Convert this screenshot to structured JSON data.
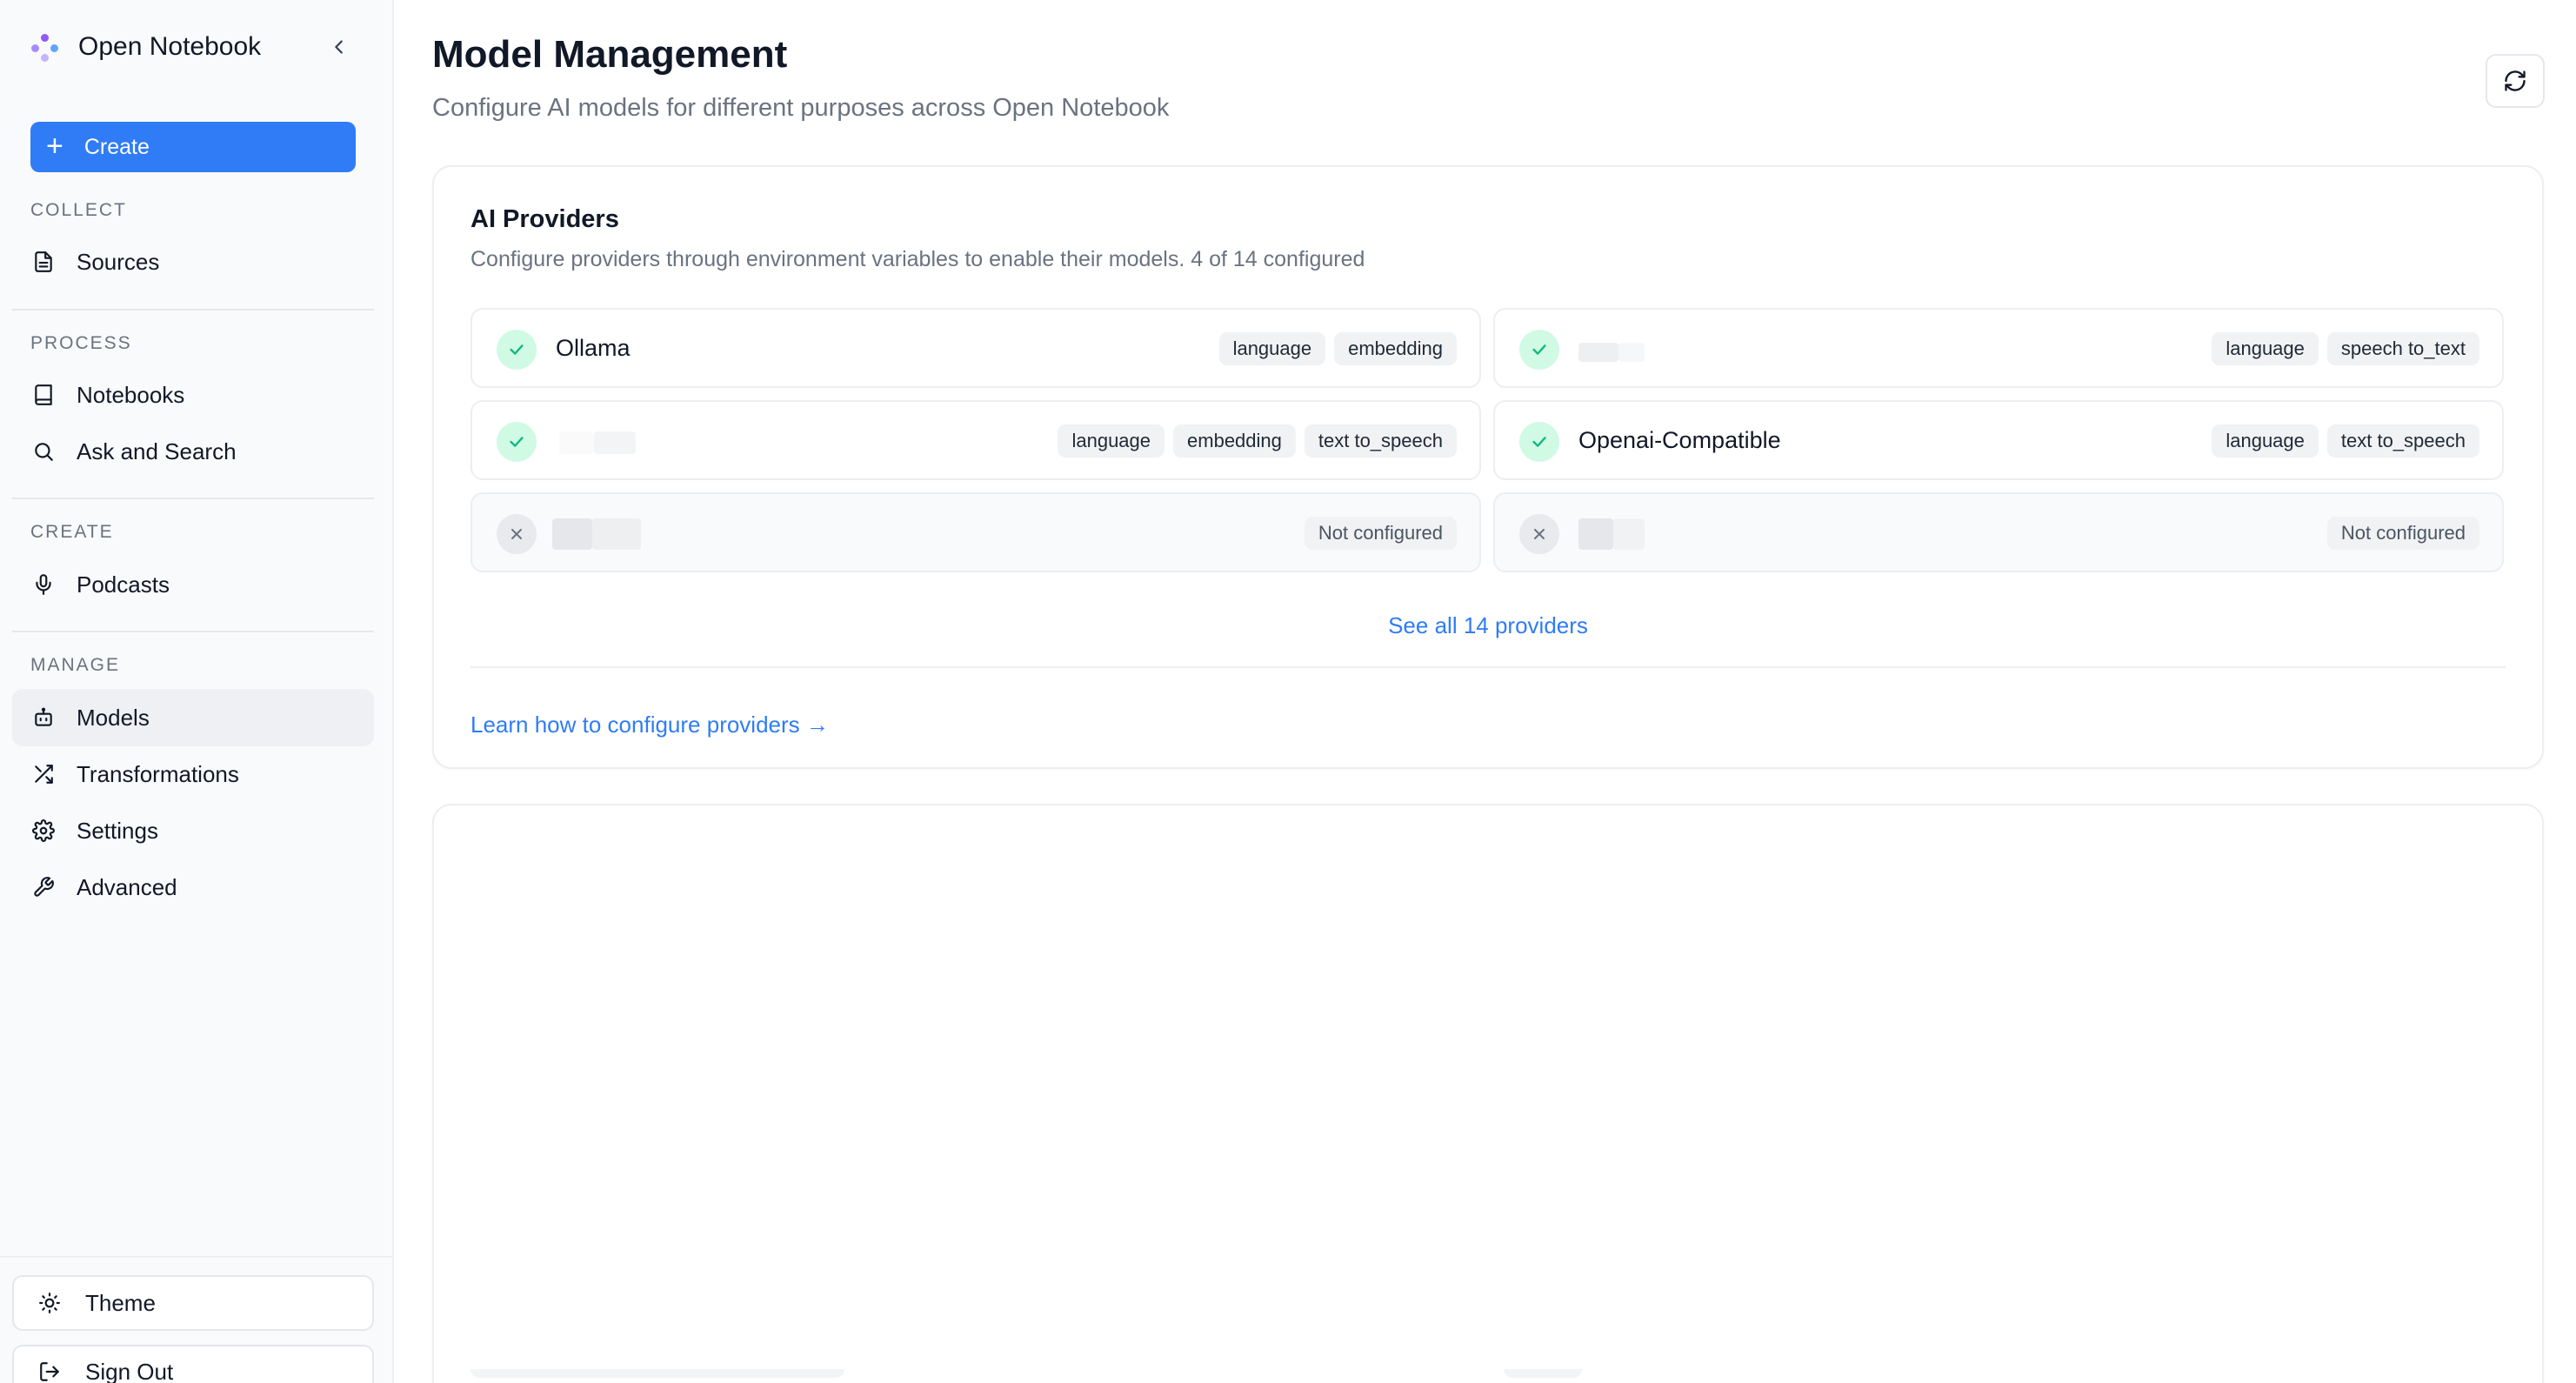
{
  "app": {
    "name": "Open Notebook",
    "create_label": "Create"
  },
  "sidebar": {
    "sections": [
      {
        "label": "COLLECT",
        "items": [
          {
            "label": "Sources",
            "icon": "file-text-icon"
          }
        ]
      },
      {
        "label": "PROCESS",
        "items": [
          {
            "label": "Notebooks",
            "icon": "book-icon"
          },
          {
            "label": "Ask and Search",
            "icon": "search-icon"
          }
        ]
      },
      {
        "label": "CREATE",
        "items": [
          {
            "label": "Podcasts",
            "icon": "mic-icon"
          }
        ]
      },
      {
        "label": "MANAGE",
        "items": [
          {
            "label": "Models",
            "icon": "bot-icon",
            "active": true
          },
          {
            "label": "Transformations",
            "icon": "shuffle-icon"
          },
          {
            "label": "Settings",
            "icon": "gear-icon"
          },
          {
            "label": "Advanced",
            "icon": "wrench-icon"
          }
        ]
      }
    ],
    "footer": {
      "theme_label": "Theme",
      "signout_label": "Sign Out"
    }
  },
  "header": {
    "title": "Model Management",
    "subtitle": "Configure AI models for different purposes across Open Notebook"
  },
  "providers_card": {
    "title": "AI Providers",
    "description": "Configure providers through environment variables to enable their models. 4 of 14 configured",
    "providers": [
      {
        "name": "Ollama",
        "configured": true,
        "tags": [
          "language",
          "embedding"
        ]
      },
      {
        "name": "",
        "configured": true,
        "tags": [
          "language",
          "speech to_text"
        ]
      },
      {
        "name": "",
        "configured": true,
        "tags": [
          "language",
          "embedding",
          "text to_speech"
        ]
      },
      {
        "name": "Openai-Compatible",
        "configured": true,
        "tags": [
          "language",
          "text to_speech"
        ]
      },
      {
        "name": "",
        "configured": false,
        "tags": [
          "Not configured"
        ]
      },
      {
        "name": "",
        "configured": false,
        "tags": [
          "Not configured"
        ]
      }
    ],
    "see_all": "See all 14 providers",
    "learn_link": "Learn how to configure providers →"
  },
  "colors": {
    "accent": "#2f7cf6",
    "configured_bg": "#d1fae5",
    "configured_check": "#10b981",
    "muted_text": "#6b7280"
  }
}
